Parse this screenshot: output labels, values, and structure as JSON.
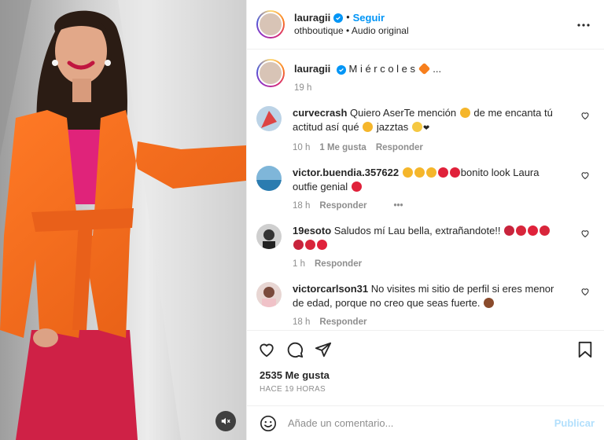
{
  "header": {
    "username": "lauragii",
    "separator": "•",
    "follow_label": "Seguir",
    "subtitle": "othboutique • Audio original"
  },
  "caption": {
    "username": "lauragii",
    "text": "M i é r c o l e s",
    "suffix": "...",
    "time": "19 h"
  },
  "comments": [
    {
      "username": "curvecrash",
      "text_a": "Quiero AserTe mención",
      "text_b": "de me encanta tú actitud así qué",
      "text_c": "jazztas",
      "time": "10 h",
      "likes": "1 Me gusta",
      "reply": "Responder"
    },
    {
      "username": "victor.buendia.357622",
      "text_a": "bonito look Laura outfie genial",
      "time": "18 h",
      "reply": "Responder",
      "more": "•••"
    },
    {
      "username": "19esoto",
      "text_a": "Saludos mí Lau bella, extrañandote!!",
      "time": "1 h",
      "reply": "Responder"
    },
    {
      "username": "victorcarlson31",
      "text_a": "No visites mi sitio de perfil si eres menor de edad, porque no creo que seas fuerte.",
      "time": "18 h",
      "reply": "Responder"
    }
  ],
  "likes": "2535 Me gusta",
  "posted": "HACE 19 HORAS",
  "composer": {
    "placeholder": "Añade un comentario...",
    "publish_label": "Publicar"
  },
  "colors": {
    "accent": "#0095f6",
    "blazer": "#f26a1b",
    "pants": "#d0234a"
  },
  "icons": [
    "heart-icon",
    "comment-icon",
    "share-icon",
    "bookmark-icon",
    "more-icon",
    "emoji-icon",
    "mute-icon",
    "verified-icon"
  ]
}
